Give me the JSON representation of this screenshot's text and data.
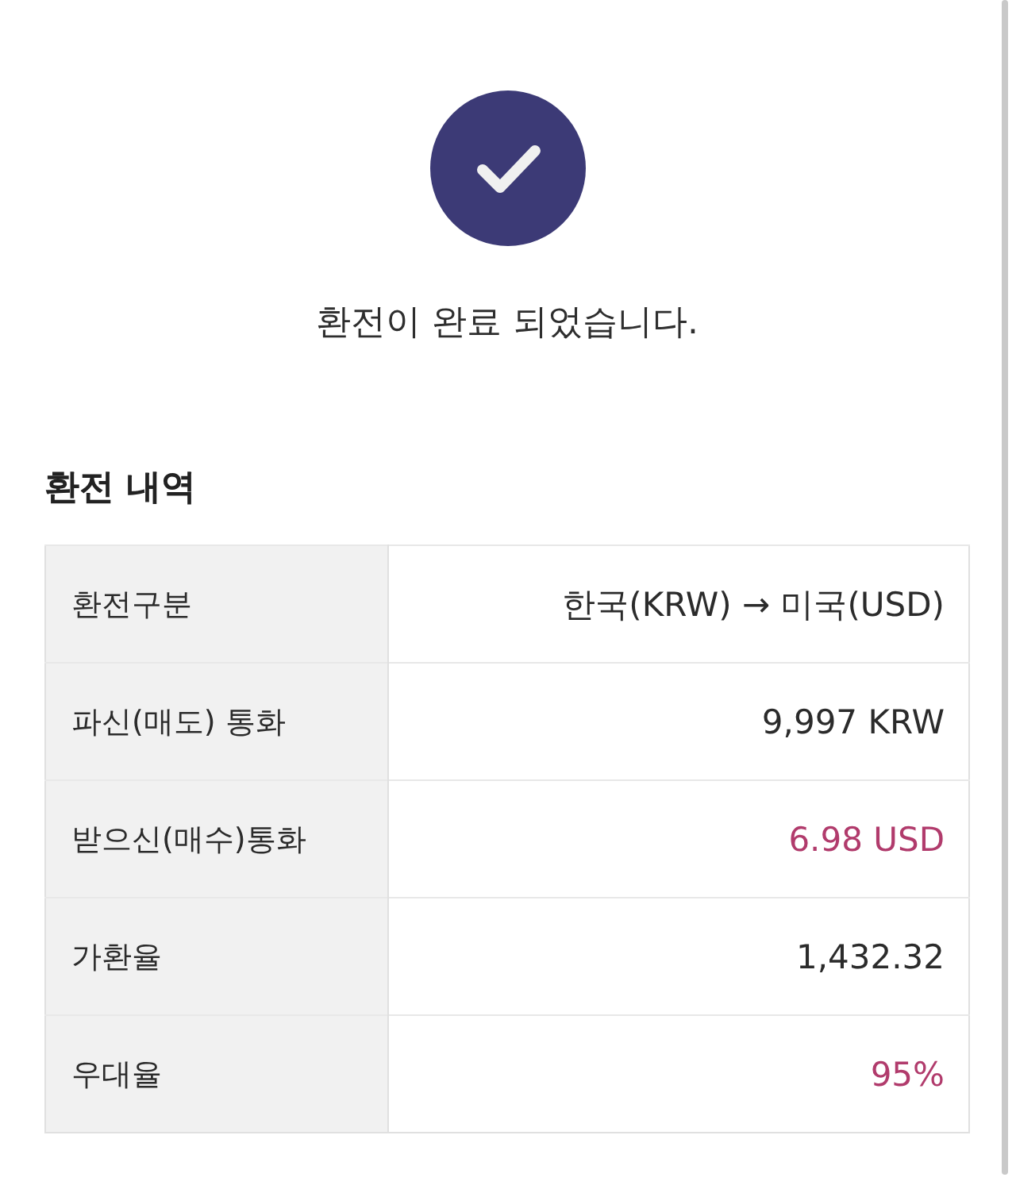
{
  "confirmation": {
    "message": "환전이 완료 되었습니다."
  },
  "history": {
    "title": "환전 내역",
    "rows": [
      {
        "label": "환전구분",
        "value": "한국(KRW) → 미국(USD)",
        "highlighted": false
      },
      {
        "label": "파신(매도) 통화",
        "value": "9,997 KRW",
        "highlighted": false
      },
      {
        "label": "받으신(매수)통화",
        "value": "6.98 USD",
        "highlighted": true
      },
      {
        "label": "가환율",
        "value": "1,432.32",
        "highlighted": false
      },
      {
        "label": "우대율",
        "value": "95%",
        "highlighted": true
      }
    ]
  }
}
